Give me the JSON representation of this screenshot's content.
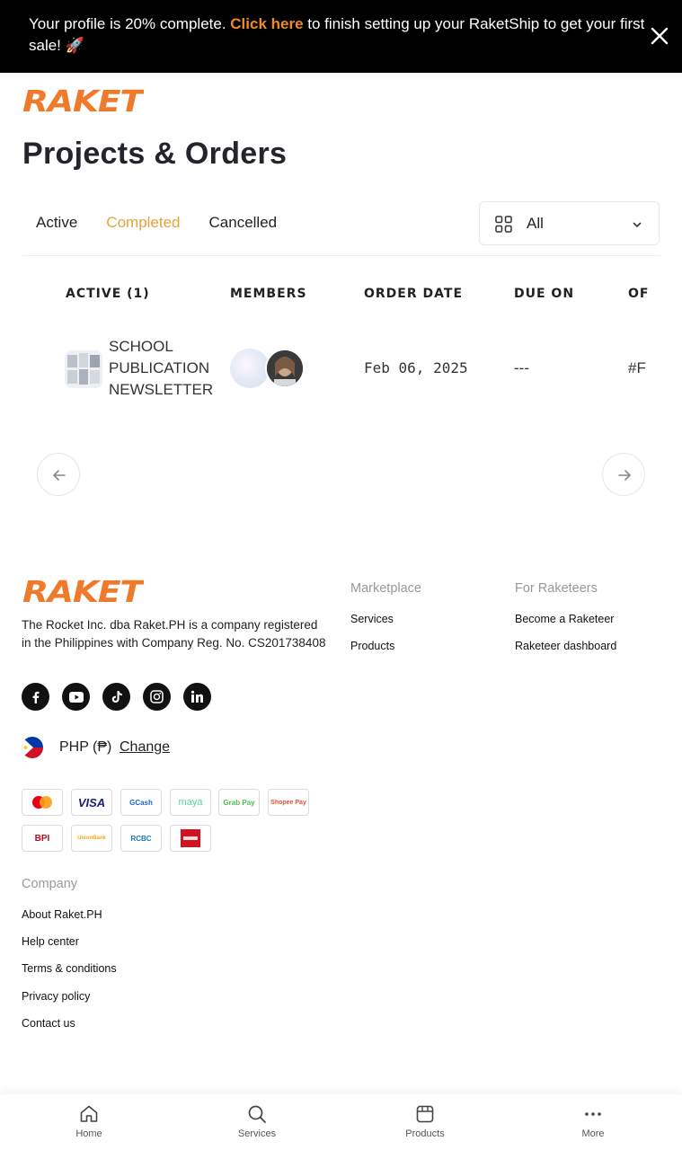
{
  "banner": {
    "text_before": "Your profile is 20% complete. ",
    "link_text": "Click here",
    "text_after": " to finish setting up your RaketShip to get your first sale! 🚀"
  },
  "brand": {
    "logo_text": "RAKET",
    "color": "#f07a2b"
  },
  "page": {
    "title": "Projects & Orders"
  },
  "tabs": [
    {
      "label": "Active",
      "selected": false
    },
    {
      "label": "Completed",
      "selected": true
    },
    {
      "label": "Cancelled",
      "selected": false
    }
  ],
  "filter": {
    "icon": "grid-icon",
    "value": "All"
  },
  "table": {
    "headers": [
      "ACTIVE (1)",
      "MEMBERS",
      "ORDER DATE",
      "DUE ON",
      "OF"
    ],
    "rows": [
      {
        "name": "SCHOOL PUBLICATION NEWSLETTER",
        "order_date": "Feb 06, 2025",
        "due_on": "---",
        "order_no": "#F"
      }
    ]
  },
  "footer": {
    "description": "The Rocket Inc. dba Raket.PH is a company registered in the Philippines with Company Reg. No. CS201738408",
    "socials": [
      "facebook-icon",
      "youtube-icon",
      "tiktok-icon",
      "instagram-icon",
      "linkedin-icon"
    ],
    "currency": {
      "label": "PHP (₱)",
      "change": "Change"
    },
    "payments": [
      "Mastercard",
      "VISA",
      "GCash",
      "maya",
      "Grab Pay",
      "Shopee Pay",
      "BPI",
      "UnionBank",
      "RCBC",
      "China Bank"
    ],
    "marketplace": {
      "heading": "Marketplace",
      "links": [
        "Services",
        "Products"
      ]
    },
    "raketeers": {
      "heading": "For Raketeers",
      "links": [
        "Become a Raketeer",
        "Raketeer dashboard"
      ]
    },
    "company": {
      "heading": "Company",
      "links": [
        "About Raket.PH",
        "Help center",
        "Terms & conditions",
        "Privacy policy",
        "Contact us"
      ]
    }
  },
  "bottom_nav": [
    {
      "label": "Home",
      "icon": "home-icon"
    },
    {
      "label": "Services",
      "icon": "search-icon"
    },
    {
      "label": "Products",
      "icon": "products-icon"
    },
    {
      "label": "More",
      "icon": "more-icon"
    }
  ]
}
